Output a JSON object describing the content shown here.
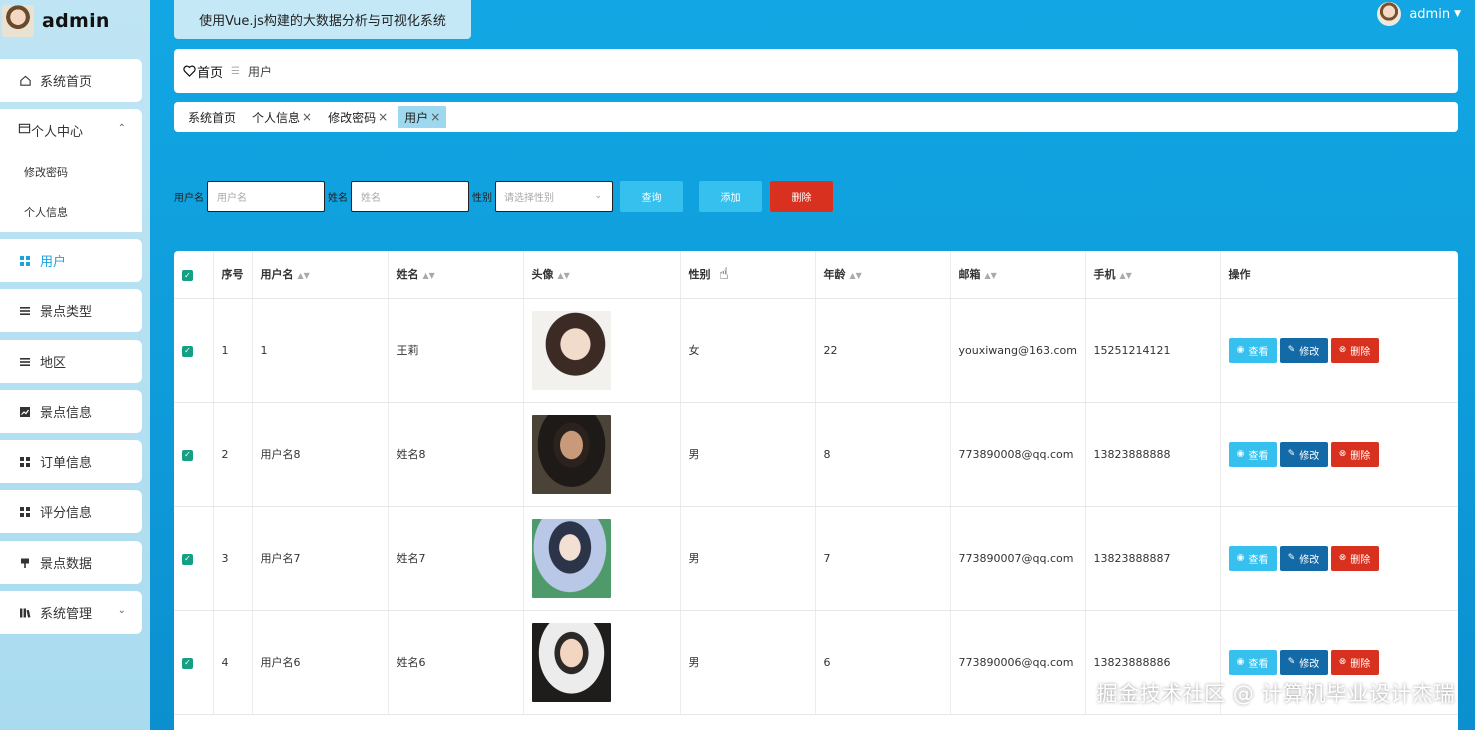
{
  "brand": {
    "name": "admin"
  },
  "sidebar": {
    "items": [
      {
        "label": "系统首页",
        "icon": "home-icon"
      },
      {
        "label": "个人中心",
        "icon": "card-icon",
        "expanded": true,
        "children": [
          {
            "label": "修改密码"
          },
          {
            "label": "个人信息"
          }
        ]
      },
      {
        "label": "用户",
        "icon": "grid-icon",
        "active": true
      },
      {
        "label": "景点类型",
        "icon": "list-icon"
      },
      {
        "label": "地区",
        "icon": "menu-icon"
      },
      {
        "label": "景点信息",
        "icon": "chart-icon"
      },
      {
        "label": "订单信息",
        "icon": "grid-icon"
      },
      {
        "label": "评分信息",
        "icon": "grid-icon"
      },
      {
        "label": "景点数据",
        "icon": "pin-icon"
      },
      {
        "label": "系统管理",
        "icon": "bars-icon"
      }
    ]
  },
  "header": {
    "system_title": "使用Vue.js构建的大数据分析与可视化系统",
    "user": "admin"
  },
  "breadcrumb": {
    "home": "首页",
    "current": "用户"
  },
  "tags": [
    {
      "label": "系统首页",
      "closable": false
    },
    {
      "label": "个人信息",
      "closable": true
    },
    {
      "label": "修改密码",
      "closable": true
    },
    {
      "label": "用户",
      "closable": true,
      "active": true
    }
  ],
  "search": {
    "username_label": "用户名",
    "username_placeholder": "用户名",
    "name_label": "姓名",
    "name_placeholder": "姓名",
    "gender_label": "性别",
    "gender_placeholder": "请选择性别",
    "query_btn": "查询",
    "add_btn": "添加",
    "delete_btn": "删除"
  },
  "table": {
    "headers": {
      "index": "序号",
      "username": "用户名",
      "name": "姓名",
      "avatar": "头像",
      "gender": "性别",
      "age": "年龄",
      "email": "邮箱",
      "phone": "手机",
      "actions": "操作"
    },
    "actions": {
      "view": "查看",
      "edit": "修改",
      "delete": "删除"
    },
    "rows": [
      {
        "index": "1",
        "username": "1",
        "name": "王莉",
        "gender": "女",
        "age": "22",
        "email": "youxiwang@163.com",
        "phone": "15251214121"
      },
      {
        "index": "2",
        "username": "用户名8",
        "name": "姓名8",
        "gender": "男",
        "age": "8",
        "email": "773890008@qq.com",
        "phone": "13823888888"
      },
      {
        "index": "3",
        "username": "用户名7",
        "name": "姓名7",
        "gender": "男",
        "age": "7",
        "email": "773890007@qq.com",
        "phone": "13823888887"
      },
      {
        "index": "4",
        "username": "用户名6",
        "name": "姓名6",
        "gender": "男",
        "age": "6",
        "email": "773890006@qq.com",
        "phone": "13823888886"
      }
    ]
  },
  "watermark": "掘金技术社区 @ 计算机毕业设计杰瑞",
  "colors": {
    "accent": "#1aa3dd",
    "primary_button": "#36c0ee",
    "edit_button": "#146aa6",
    "danger_button": "#d9311f",
    "checkbox": "#14a085"
  }
}
